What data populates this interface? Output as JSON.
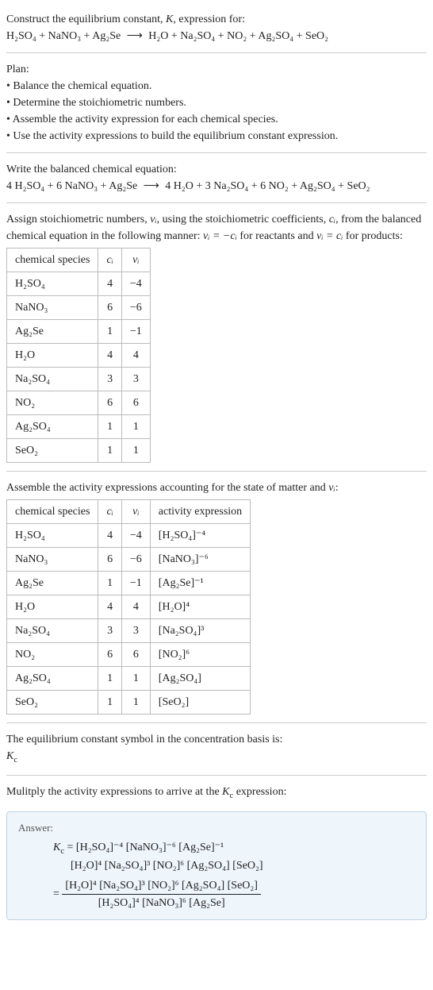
{
  "intro": {
    "line1_a": "Construct the equilibrium constant, ",
    "line1_K": "K",
    "line1_b": ", expression for:",
    "eq_lhs": "H₂SO₄ + NaNO₃ + Ag₂Se",
    "eq_arrow": "⟶",
    "eq_rhs": "H₂O + Na₂SO₄ + NO₂ + Ag₂SO₄ + SeO₂"
  },
  "plan": {
    "heading": "Plan:",
    "b1": "• Balance the chemical equation.",
    "b2": "• Determine the stoichiometric numbers.",
    "b3": "• Assemble the activity expression for each chemical species.",
    "b4": "• Use the activity expressions to build the equilibrium constant expression."
  },
  "balanced": {
    "heading": "Write the balanced chemical equation:",
    "eq_lhs": "4 H₂SO₄ + 6 NaNO₃ + Ag₂Se",
    "eq_arrow": "⟶",
    "eq_rhs": "4 H₂O + 3 Na₂SO₄ + 6 NO₂ + Ag₂SO₄ + SeO₂"
  },
  "stoich": {
    "para_a": "Assign stoichiometric numbers, ",
    "nu_i": "νᵢ",
    "para_b": ", using the stoichiometric coefficients, ",
    "c_i": "cᵢ",
    "para_c": ", from the balanced chemical equation in the following manner: ",
    "rel1": "νᵢ = −cᵢ",
    "para_d": " for reactants and ",
    "rel2": "νᵢ = cᵢ",
    "para_e": " for products:",
    "hdr_species": "chemical species",
    "hdr_c": "cᵢ",
    "hdr_nu": "νᵢ",
    "rows": [
      {
        "sp": "H₂SO₄",
        "c": "4",
        "nu": "−4"
      },
      {
        "sp": "NaNO₃",
        "c": "6",
        "nu": "−6"
      },
      {
        "sp": "Ag₂Se",
        "c": "1",
        "nu": "−1"
      },
      {
        "sp": "H₂O",
        "c": "4",
        "nu": "4"
      },
      {
        "sp": "Na₂SO₄",
        "c": "3",
        "nu": "3"
      },
      {
        "sp": "NO₂",
        "c": "6",
        "nu": "6"
      },
      {
        "sp": "Ag₂SO₄",
        "c": "1",
        "nu": "1"
      },
      {
        "sp": "SeO₂",
        "c": "1",
        "nu": "1"
      }
    ]
  },
  "activity": {
    "para_a": "Assemble the activity expressions accounting for the state of matter and ",
    "nu_i": "νᵢ",
    "para_b": ":",
    "hdr_species": "chemical species",
    "hdr_c": "cᵢ",
    "hdr_nu": "νᵢ",
    "hdr_act": "activity expression",
    "rows": [
      {
        "sp": "H₂SO₄",
        "c": "4",
        "nu": "−4",
        "act": "[H₂SO₄]⁻⁴"
      },
      {
        "sp": "NaNO₃",
        "c": "6",
        "nu": "−6",
        "act": "[NaNO₃]⁻⁶"
      },
      {
        "sp": "Ag₂Se",
        "c": "1",
        "nu": "−1",
        "act": "[Ag₂Se]⁻¹"
      },
      {
        "sp": "H₂O",
        "c": "4",
        "nu": "4",
        "act": "[H₂O]⁴"
      },
      {
        "sp": "Na₂SO₄",
        "c": "3",
        "nu": "3",
        "act": "[Na₂SO₄]³"
      },
      {
        "sp": "NO₂",
        "c": "6",
        "nu": "6",
        "act": "[NO₂]⁶"
      },
      {
        "sp": "Ag₂SO₄",
        "c": "1",
        "nu": "1",
        "act": "[Ag₂SO₄]"
      },
      {
        "sp": "SeO₂",
        "c": "1",
        "nu": "1",
        "act": "[SeO₂]"
      }
    ]
  },
  "symbol": {
    "line1": "The equilibrium constant symbol in the concentration basis is:",
    "Kc": "K_c"
  },
  "multiply": {
    "para_a": "Mulitply the activity expressions to arrive at the ",
    "Kc": "K_c",
    "para_b": " expression:"
  },
  "answer": {
    "label": "Answer:",
    "line1_lhs": "K_c = ",
    "line1_rhs": "[H₂SO₄]⁻⁴ [NaNO₃]⁻⁶ [Ag₂Se]⁻¹",
    "line2": "[H₂O]⁴ [Na₂SO₄]³ [NO₂]⁶ [Ag₂SO₄] [SeO₂]",
    "eq_lead": "= ",
    "frac_num": "[H₂O]⁴ [Na₂SO₄]³ [NO₂]⁶ [Ag₂SO₄] [SeO₂]",
    "frac_den": "[H₂SO₄]⁴ [NaNO₃]⁶ [Ag₂Se]"
  }
}
